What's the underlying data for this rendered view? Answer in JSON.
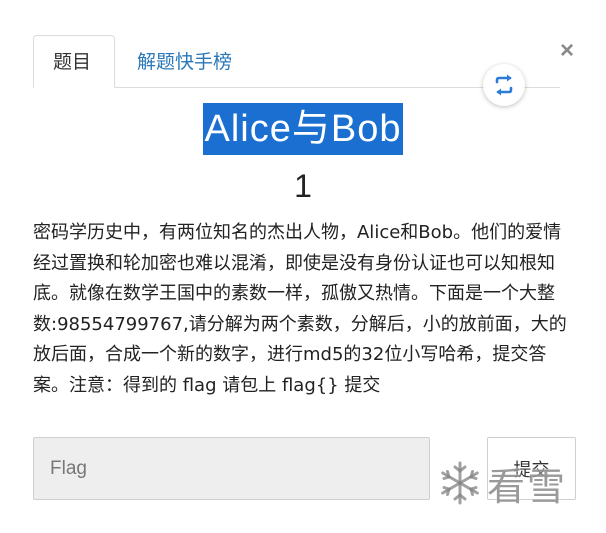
{
  "tabs": [
    {
      "label": "题目"
    },
    {
      "label": "解题快手榜"
    }
  ],
  "close_label": "×",
  "challenge": {
    "title": "Alice与Bob",
    "points": "1",
    "description": "密码学历史中，有两位知名的杰出人物，Alice和Bob。他们的爱情经过置换和轮加密也难以混淆，即使是没有身份认证也可以知根知底。就像在数学王国中的素数一样，孤傲又热情。下面是一个大整数:98554799767,请分解为两个素数，分解后，小的放前面，大的放后面，合成一个新的数字，进行md5的32位小写哈希，提交答案。注意：得到的 flag 请包上 flag{} 提交"
  },
  "flag_form": {
    "placeholder": "Flag",
    "value": "",
    "submit_label": "提交"
  },
  "watermark": {
    "text": "看雪"
  },
  "colors": {
    "accent": "#1a6fd0",
    "link": "#2a78b8",
    "swap_icon": "#2b7bd9"
  },
  "icons": {
    "close": "close-icon",
    "swap": "swap-arrows-icon",
    "watermark": "snowflake-icon"
  }
}
